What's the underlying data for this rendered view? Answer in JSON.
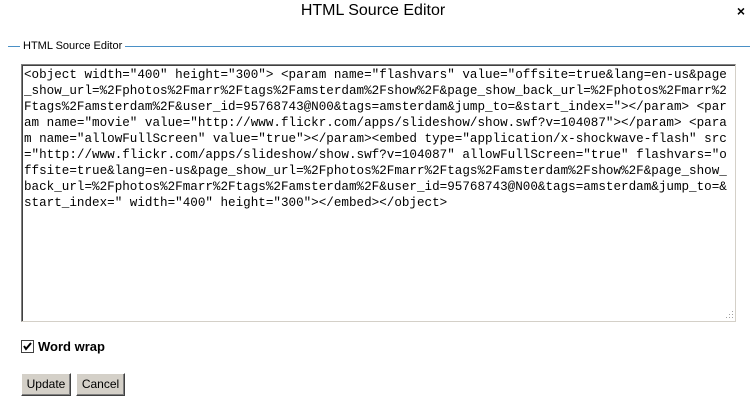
{
  "dialog": {
    "title": "HTML Source Editor",
    "close_label": "×"
  },
  "section": {
    "legend": "HTML Source Editor"
  },
  "editor": {
    "content": "<object width=\"400\" height=\"300\"> <param name=\"flashvars\" value=\"offsite=true&lang=en-us&page_show_url=%2Fphotos%2Fmarr%2Ftags%2Famsterdam%2Fshow%2F&page_show_back_url=%2Fphotos%2Fmarr%2Ftags%2Famsterdam%2F&user_id=95768743@N00&tags=amsterdam&jump_to=&start_index=\"></param> <param name=\"movie\" value=\"http://www.flickr.com/apps/slideshow/show.swf?v=104087\"></param> <param name=\"allowFullScreen\" value=\"true\"></param><embed type=\"application/x-shockwave-flash\" src=\"http://www.flickr.com/apps/slideshow/show.swf?v=104087\" allowFullScreen=\"true\" flashvars=\"offsite=true&lang=en-us&page_show_url=%2Fphotos%2Fmarr%2Ftags%2Famsterdam%2Fshow%2F&page_show_back_url=%2Fphotos%2Fmarr%2Ftags%2Famsterdam%2F&user_id=95768743@N00&tags=amsterdam&jump_to=&start_index=\" width=\"400\" height=\"300\"></embed></object>"
  },
  "options": {
    "word_wrap_label": "Word wrap",
    "word_wrap_checked": true
  },
  "buttons": {
    "update_label": "Update",
    "cancel_label": "Cancel"
  },
  "colors": {
    "legend_rule": "#4a90c6",
    "button_face": "#d4d0c8"
  }
}
